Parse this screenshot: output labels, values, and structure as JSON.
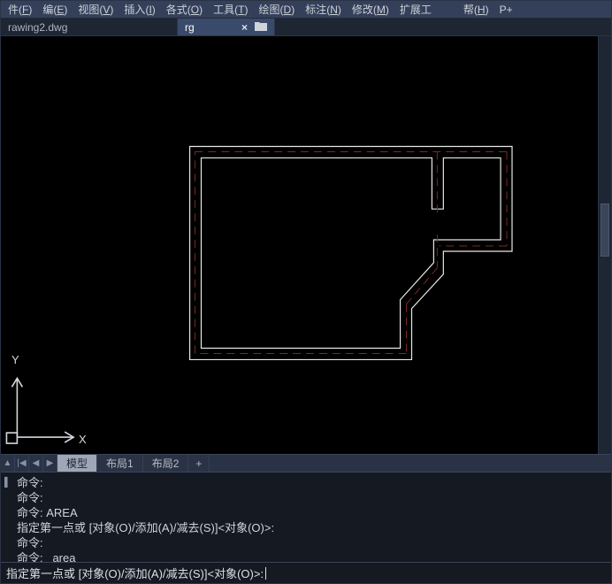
{
  "menu": {
    "items": [
      {
        "label": "件",
        "key": "F"
      },
      {
        "label": "编",
        "key": "E"
      },
      {
        "label": "视图",
        "key": "V"
      },
      {
        "label": "插入",
        "key": "I"
      },
      {
        "label": "各式",
        "key": "O"
      },
      {
        "label": "工具",
        "key": "T"
      },
      {
        "label": "绘图",
        "key": "D"
      },
      {
        "label": "标注",
        "key": "N"
      },
      {
        "label": "修改",
        "key": "M"
      },
      {
        "label": "扩展工",
        "key": ""
      },
      {
        "label": "",
        "key": ""
      },
      {
        "label": "",
        "key": ""
      },
      {
        "label": "帮",
        "key": "H"
      },
      {
        "label": "P+",
        "key": ""
      }
    ]
  },
  "tabs": {
    "items": [
      {
        "label": "rawing2.dwg",
        "active": false
      },
      {
        "label": "rg",
        "active": true
      }
    ]
  },
  "ucs": {
    "x": "X",
    "y": "Y"
  },
  "layout": {
    "nav": {
      "up": "▲",
      "first": "|◀",
      "prev": "◀",
      "next": "▶"
    },
    "tabs": [
      {
        "label": "模型",
        "active": true
      },
      {
        "label": "布局1",
        "active": false
      },
      {
        "label": "布局2",
        "active": false
      }
    ],
    "plus": "+"
  },
  "command_history": {
    "lines": [
      "命令:",
      "命令:",
      "命令: AREA",
      "指定第一点或 [对象(O)/添加(A)/减去(S)]<对象(O)>:",
      "命令:",
      "命令: _area"
    ]
  },
  "command_input": {
    "prompt": "指定第一点或 [对象(O)/添加(A)/减去(S)]<对象(O)>:"
  }
}
